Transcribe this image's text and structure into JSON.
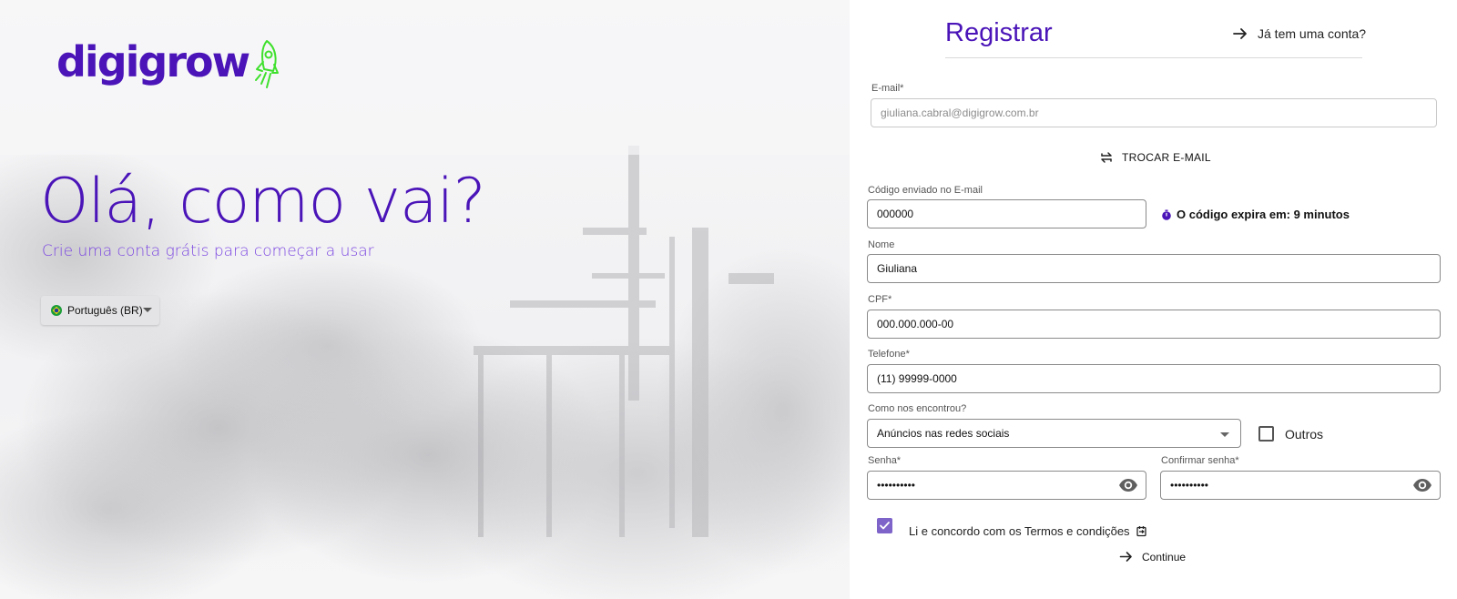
{
  "brand": {
    "name": "digigrow",
    "color": "#4a14b8",
    "rocket_color": "#3fe02d"
  },
  "hero": {
    "headline": "Olá, como vai?",
    "subline": "Crie uma conta grátis para começar a usar",
    "language": {
      "selected": "Português (BR)",
      "icon": "brazil-flag-icon"
    }
  },
  "form": {
    "title": "Registrar",
    "login_link": "Já tem uma conta?",
    "email": {
      "label": "E-mail*",
      "value": "giuliana.cabral@digigrow.com.br"
    },
    "swap_email": "TROCAR E-MAIL",
    "code": {
      "label": "Código enviado no E-mail",
      "value": "000000"
    },
    "code_expiry": "O código expira em: 9 minutos",
    "name": {
      "label": "Nome",
      "value": "Giuliana"
    },
    "cpf": {
      "label": "CPF*",
      "value": "000.000.000-00"
    },
    "phone": {
      "label": "Telefone*",
      "value": "(11) 99999-0000"
    },
    "source": {
      "label": "Como nos encontrou?",
      "value": "Anúncios nas redes sociais"
    },
    "other": {
      "label": "Outros",
      "checked": false
    },
    "password": {
      "label": "Senha*",
      "value": "••••••••••"
    },
    "confirm_password": {
      "label": "Confirmar senha*",
      "value": "••••••••••"
    },
    "terms": {
      "label": "Li e concordo com os Termos e condições",
      "checked": true
    },
    "continue": "Continue",
    "accent": "#7e63c9"
  }
}
